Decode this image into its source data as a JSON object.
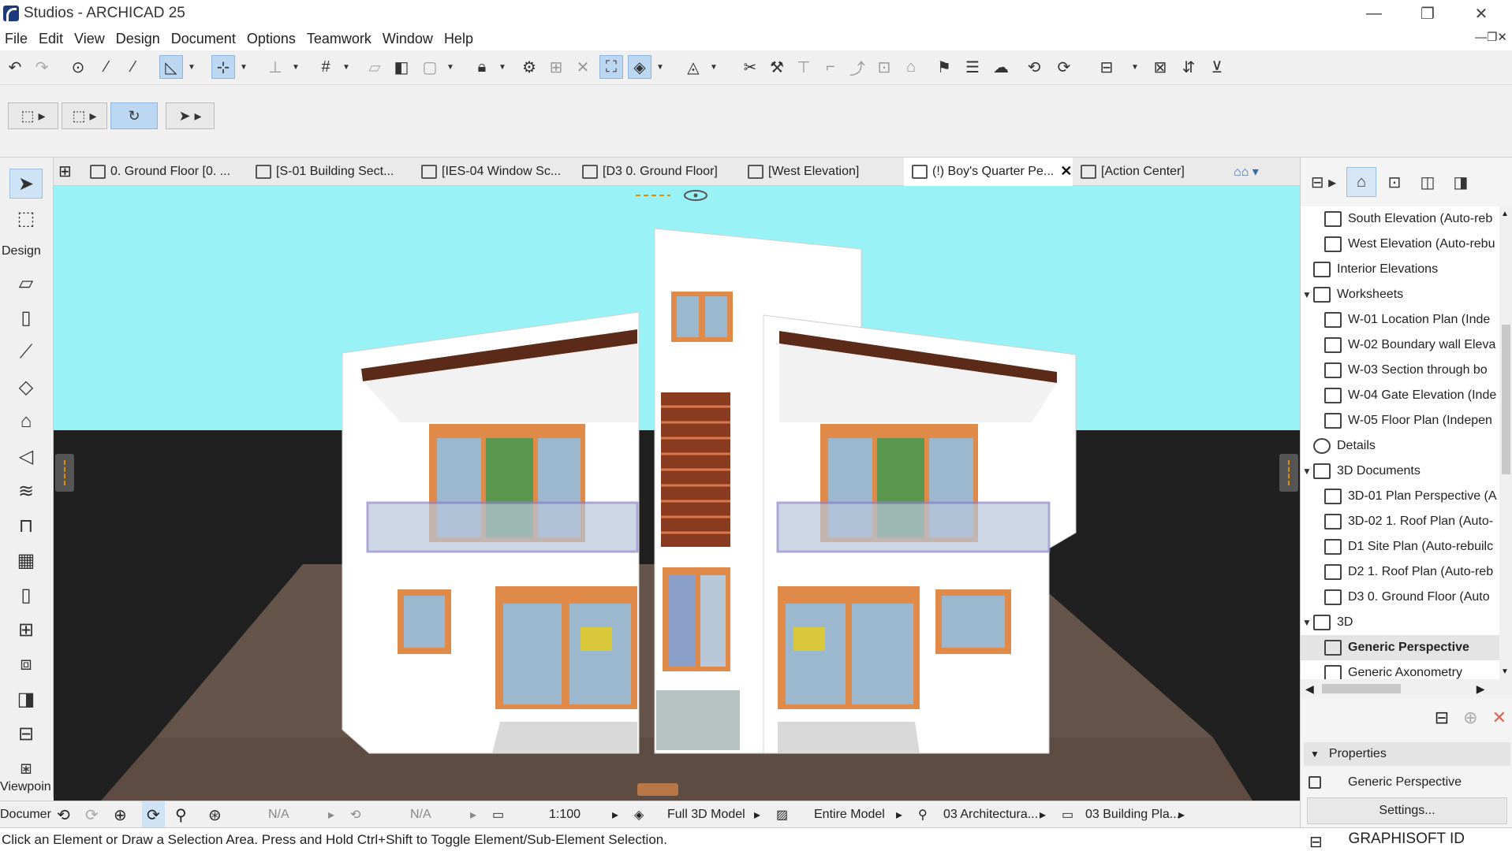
{
  "window": {
    "title": "Studios - ARCHICAD 25",
    "minimize": "—",
    "restore": "❐",
    "close": "✕"
  },
  "menu": {
    "items": [
      "File",
      "Edit",
      "View",
      "Design",
      "Document",
      "Options",
      "Teamwork",
      "Window",
      "Help"
    ],
    "right_controls": "—❐✕"
  },
  "toolbox": {
    "design_label": "Design",
    "viewpoint_label": "Viewpoin",
    "document_label": "Documer"
  },
  "tabs": [
    {
      "label": "0. Ground Floor [0. ...",
      "icon": "floor-plan-icon"
    },
    {
      "label": "[S-01 Building Sect...",
      "icon": "section-icon"
    },
    {
      "label": "[IES-04 Window Sc...",
      "icon": "schedule-icon"
    },
    {
      "label": "[D3 0. Ground Floor]",
      "icon": "3d-document-icon"
    },
    {
      "label": "[West Elevation]",
      "icon": "elevation-icon"
    },
    {
      "label": "(!) Boy's Quarter Pe...",
      "icon": "perspective-icon",
      "active": true,
      "close": "✕"
    },
    {
      "label": "[Action Center]",
      "icon": "action-center-icon"
    }
  ],
  "status_controls": {
    "zoom_na_1": "N/A",
    "zoom_na_2": "N/A",
    "scale": "1:100",
    "model_view": "Full 3D Model",
    "filter": "Entire Model",
    "pen_set": "03 Architectura...",
    "layer_combo": "03 Building Pla..."
  },
  "navigator": {
    "items": [
      {
        "label": "South Elevation (Auto-reb",
        "level": 2,
        "icon": "elevation-icon"
      },
      {
        "label": "West Elevation (Auto-rebu",
        "level": 2,
        "icon": "elevation-icon"
      },
      {
        "label": "Interior Elevations",
        "level": 1,
        "icon": "interior-elevation-icon"
      },
      {
        "label": "Worksheets",
        "level": 1,
        "icon": "worksheet-icon",
        "expanded": true
      },
      {
        "label": "W-01 Location Plan (Inde",
        "level": 2,
        "icon": "worksheet-icon"
      },
      {
        "label": "W-02 Boundary wall Eleva",
        "level": 2,
        "icon": "worksheet-icon"
      },
      {
        "label": "W-03 Section through bo",
        "level": 2,
        "icon": "worksheet-icon"
      },
      {
        "label": "W-04 Gate Elevation (Inde",
        "level": 2,
        "icon": "worksheet-icon"
      },
      {
        "label": "W-05 Floor Plan (Indepen",
        "level": 2,
        "icon": "worksheet-icon"
      },
      {
        "label": "Details",
        "level": 1,
        "icon": "details-icon"
      },
      {
        "label": "3D Documents",
        "level": 1,
        "icon": "3d-document-icon",
        "expanded": true
      },
      {
        "label": "3D-01 Plan Perspective (A",
        "level": 2,
        "icon": "3d-document-icon"
      },
      {
        "label": "3D-02 1. Roof Plan (Auto-",
        "level": 2,
        "icon": "3d-document-icon"
      },
      {
        "label": "D1 Site Plan (Auto-rebuilc",
        "level": 2,
        "icon": "3d-document-icon"
      },
      {
        "label": "D2 1. Roof Plan (Auto-reb",
        "level": 2,
        "icon": "3d-document-icon"
      },
      {
        "label": "D3 0. Ground Floor (Auto",
        "level": 2,
        "icon": "3d-document-icon"
      },
      {
        "label": "3D",
        "level": 1,
        "icon": "3d-icon",
        "expanded": true
      },
      {
        "label": "Generic Perspective",
        "level": 2,
        "icon": "perspective-icon",
        "selected": true
      },
      {
        "label": "Generic Axonometry",
        "level": 2,
        "icon": "axonometry-icon"
      }
    ],
    "properties_header": "Properties",
    "properties_value": "Generic Perspective",
    "settings_label": "Settings..."
  },
  "statusbar": {
    "message": "Click an Element or Draw a Selection Area. Press and Hold Ctrl+Shift to Toggle Element/Sub-Element Selection.",
    "brand": "GRAPHISOFT ID"
  },
  "colors": {
    "sky": "#98f2f6",
    "ground": "#202020",
    "wall": "#ffffff",
    "frame": "#e08a4a",
    "glass": "#9bb8cf",
    "louver": "#8a3a1e",
    "paving": "#5e4c42"
  }
}
